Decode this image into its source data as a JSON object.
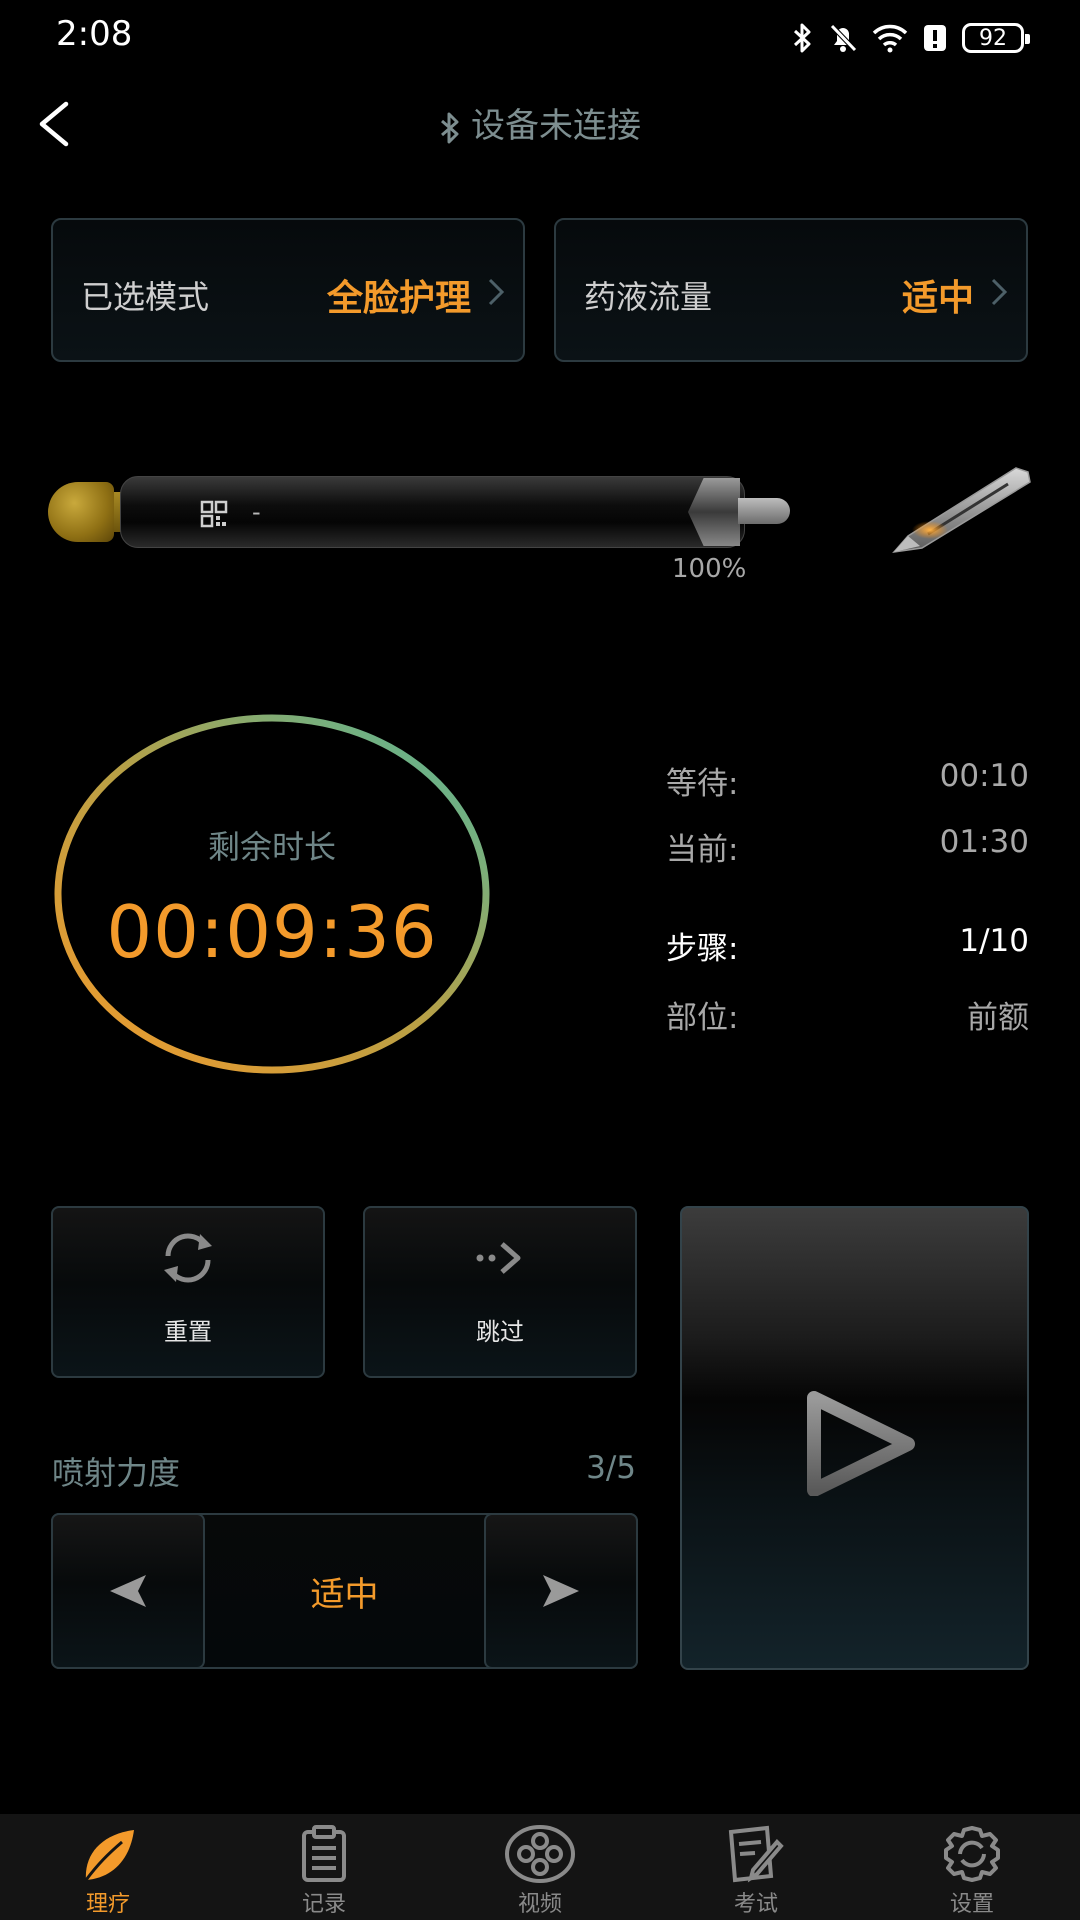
{
  "status_bar": {
    "time": "2:08",
    "battery": "92"
  },
  "header": {
    "title": "设备未连接"
  },
  "mode_card": {
    "label": "已选模式",
    "value": "全脸护理"
  },
  "flow_card": {
    "label": "药液流量",
    "value": "适中"
  },
  "device": {
    "dash": "-",
    "percent": "100%"
  },
  "timer": {
    "label": "剩余时长",
    "value": "00:09:36"
  },
  "info": {
    "wait": {
      "label": "等待:",
      "value": "00:10"
    },
    "current": {
      "label": "当前:",
      "value": "01:30"
    },
    "step": {
      "label": "步骤:",
      "value": "1/10"
    },
    "area": {
      "label": "部位:",
      "value": "前额"
    }
  },
  "actions": {
    "reset": "重置",
    "skip": "跳过"
  },
  "spray": {
    "label": "喷射力度",
    "value": "3/5",
    "level": "适中"
  },
  "nav": [
    {
      "label": "理疗",
      "icon": "leaf-icon",
      "active": true
    },
    {
      "label": "记录",
      "icon": "clipboard-icon",
      "active": false
    },
    {
      "label": "视频",
      "icon": "film-reel-icon",
      "active": false
    },
    {
      "label": "考试",
      "icon": "exam-edit-icon",
      "active": false
    },
    {
      "label": "设置",
      "icon": "gear-icon",
      "active": false
    }
  ],
  "colors": {
    "accent": "#f39a2b",
    "ring_start": "#f39a2b",
    "ring_end": "#4fb8a0",
    "muted": "#6f8688"
  }
}
